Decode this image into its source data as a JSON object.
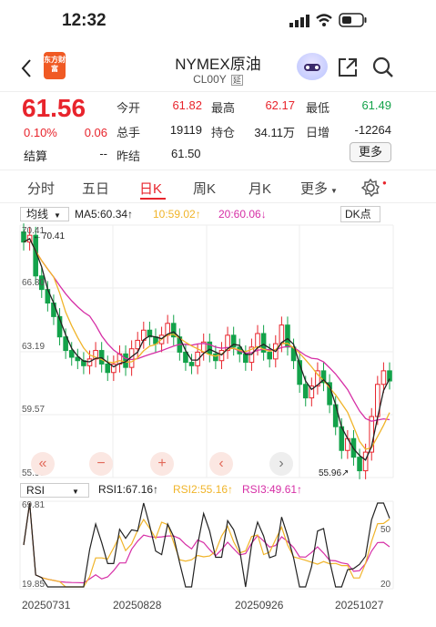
{
  "status": {
    "time": "12:32"
  },
  "header": {
    "symbol_name": "NYMEX原油",
    "code": "CL00Y",
    "delay_badge": "延",
    "logo_text": "东方财富"
  },
  "quote": {
    "price": "61.56",
    "change_pct": "0.10%",
    "change": "0.06",
    "fields": [
      {
        "label": "今开",
        "value": "61.82"
      },
      {
        "label": "最高",
        "value": "62.17"
      },
      {
        "label": "最低",
        "value": "61.49"
      },
      {
        "label": "总手",
        "value": "19119"
      },
      {
        "label": "持仓",
        "value": "34.11万"
      },
      {
        "label": "日增",
        "value": "-12264"
      },
      {
        "label": "结算",
        "value": "--"
      },
      {
        "label": "昨结",
        "value": "61.50"
      }
    ],
    "more_button": "更多"
  },
  "tabs": [
    "分时",
    "五日",
    "日K",
    "周K",
    "月K",
    "更多"
  ],
  "active_tab": "日K",
  "indicators": {
    "ma_dropdown": "均线",
    "ma5": "MA5:60.34",
    "ma10": "10:59.02",
    "ma20": "20:60.06",
    "dk_button": "DK点",
    "price_axis": [
      "70.41",
      "66.80",
      "63.19",
      "59.57",
      "55.96"
    ],
    "high_label": "70.41",
    "low_label": "55.96"
  },
  "rsi": {
    "dropdown": "RSI",
    "rsi1": "RSI1:67.16",
    "rsi2": "RSI2:55.16",
    "rsi3": "RSI3:49.61",
    "axis_left_top": "69.81",
    "axis_left_bottom": "19.85",
    "axis_right_mid": "50",
    "axis_right_bottom": "20"
  },
  "dates": [
    "20250731",
    "20250828",
    "20250926",
    "20251027"
  ],
  "colors": {
    "up": "#e8242c",
    "down": "#13a24a",
    "ma5": "#222222",
    "ma10": "#f0b429",
    "ma20": "#d62fa6"
  }
}
